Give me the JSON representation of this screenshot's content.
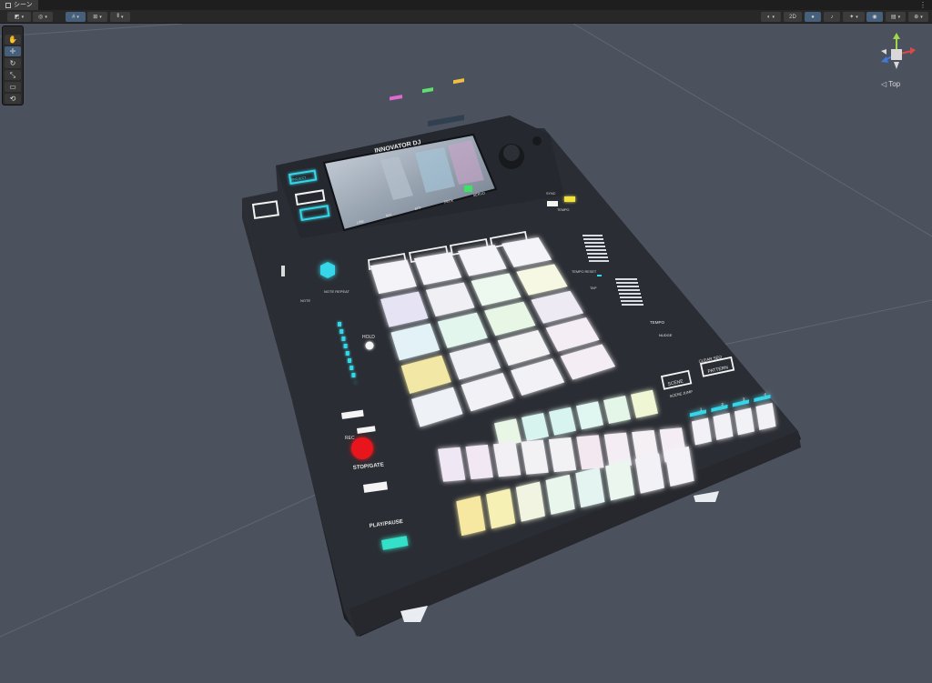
{
  "tab": {
    "label": "シーン"
  },
  "toolbar": {
    "view_2d": "2D"
  },
  "gizmo": {
    "label": "◁ Top"
  },
  "device": {
    "brand": "INNOVATOR DJ",
    "screen_labels": [
      "LINK",
      "MIX",
      "EFF",
      "DECK",
      "SERVO"
    ],
    "labels": {
      "project": "PROJECT",
      "note": "NOTE",
      "repeat": "NOTE REPEAT",
      "hold": "HOLD",
      "rec": "REC",
      "stop_gate": "STOP/GATE",
      "play_pause": "PLAY/PAUSE",
      "scene": "SCENE",
      "pattern": "PATTERN",
      "clear_seq": "CLEAR SEQ",
      "scene_jump": "SCENE JUMP",
      "tempo": "TEMPO",
      "tempo_reset": "TEMPO RESET",
      "nudge": "NUDGE",
      "tap": "TAP",
      "knob_label": "TEMPO",
      "sync": "SYNC"
    },
    "scene_numbers": [
      "1",
      "2",
      "3",
      "4"
    ],
    "pad_colors": [
      [
        "#f4f4f8",
        "#f4f4f8",
        "#f4f4f8",
        "#f4f4f8"
      ],
      [
        "#e6e4f4",
        "#f0f0f4",
        "#edf8ee",
        "#f6f8e4"
      ],
      [
        "#e2f2f6",
        "#e2f6ee",
        "#e8f6e6",
        "#eeeaf4"
      ],
      [
        "#f2e7a4",
        "#eef0f6",
        "#f2f2f4",
        "#f4eef4"
      ],
      [
        "#eef2f6",
        "#f2f2f6",
        "#f2f2f6",
        "#f4eef4"
      ]
    ],
    "strip_top_colors": [
      "#e8f6e6",
      "#d7f4ef",
      "#d7f4f1",
      "#e0f7f1",
      "#e4f6e8",
      "#eef6d4"
    ],
    "strip_mid_colors": [
      "#f0e7f4",
      "#f2e8f4",
      "#f2f0f4",
      "#f2f2f4",
      "#f2f2f4",
      "#f4e8f0",
      "#f4eef4",
      "#f4f0f4",
      "#f4eef4"
    ],
    "strip_bot_colors": [
      "#f6e8a0",
      "#f6f0b4",
      "#f0f4e0",
      "#e8f6ec",
      "#e4f4f0",
      "#eaf6ee",
      "#f2f2f6",
      "#f4f2f6"
    ],
    "accent": "#36d6e8"
  }
}
